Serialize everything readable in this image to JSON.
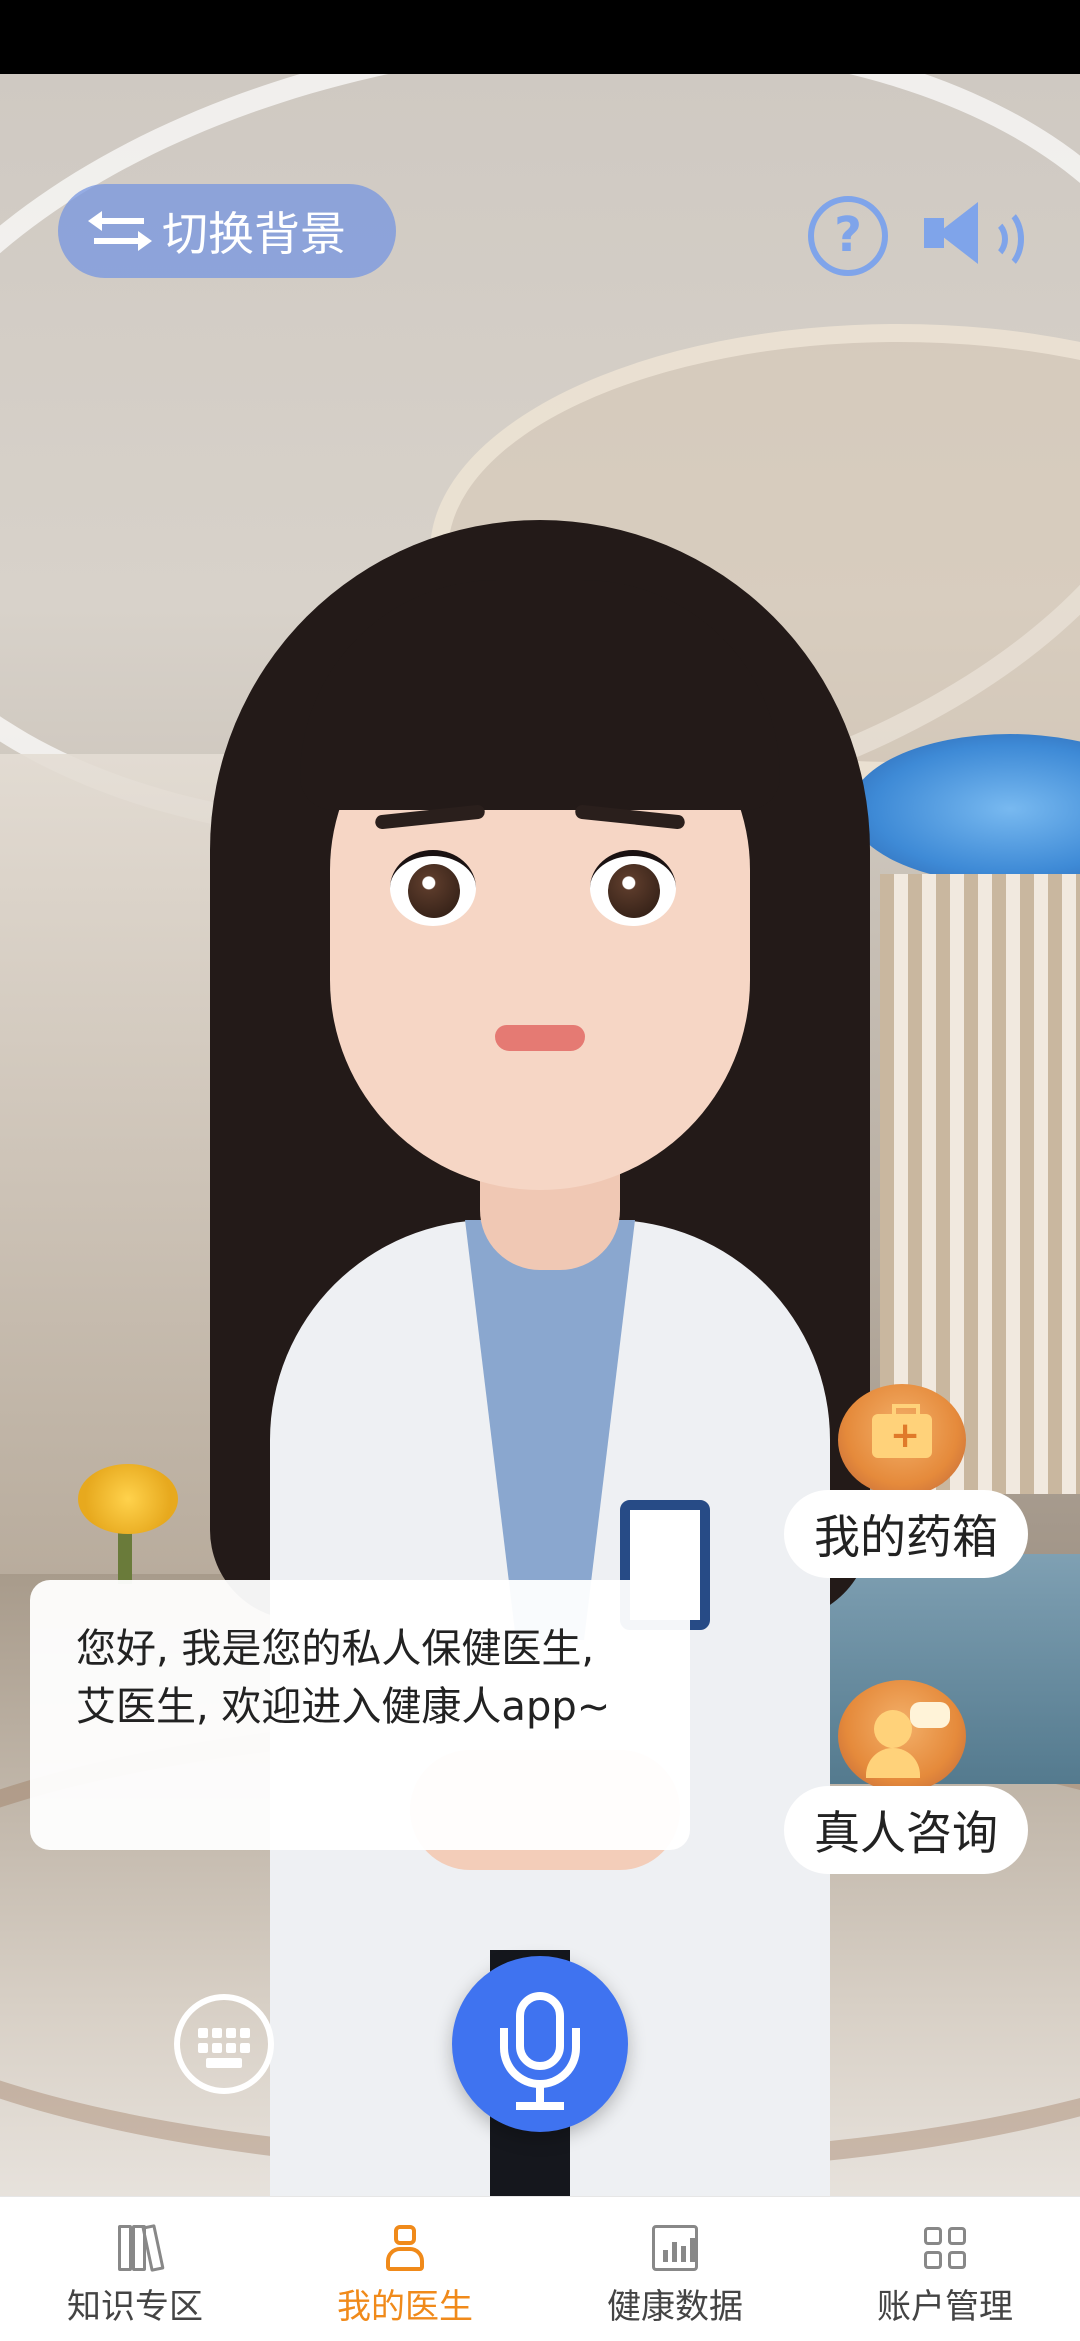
{
  "top_bar": {
    "switch_background_label": "切换背景",
    "help_icon": "question-circle-icon",
    "sound_icon": "speaker-icon"
  },
  "side_actions": {
    "medicine_box_label": "我的药箱",
    "human_consult_label": "真人咨询"
  },
  "speech_bubble": {
    "text": "您好, 我是您的私人保健医生, 艾医生, 欢迎进入健康人app~"
  },
  "controls": {
    "keyboard_icon": "keyboard-icon",
    "mic_icon": "microphone-icon"
  },
  "tabbar": {
    "tabs": [
      {
        "label": "知识专区",
        "icon": "books-icon",
        "active": false
      },
      {
        "label": "我的医生",
        "icon": "doctor-icon",
        "active": true
      },
      {
        "label": "健康数据",
        "icon": "calendar-chart-icon",
        "active": false
      },
      {
        "label": "账户管理",
        "icon": "grid-icon",
        "active": false
      }
    ],
    "active_color": "#f08a1a"
  },
  "colors": {
    "accent_blue": "#3f73f0",
    "pill_blue": "#7696e0",
    "orange": "#f08a1a"
  }
}
